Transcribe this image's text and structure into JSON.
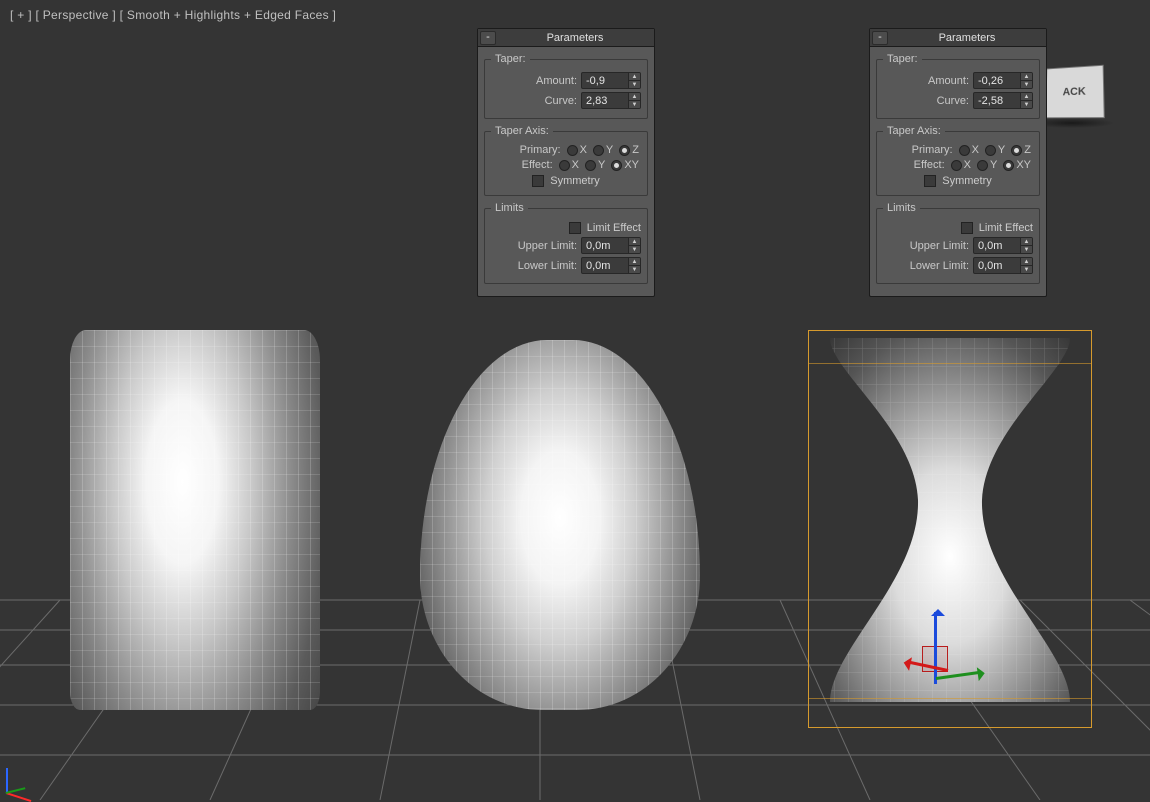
{
  "viewport_label": "[ + ] [ Perspective ] [ Smooth + Highlights + Edged Faces ]",
  "viewcube_face": "ACK",
  "panels": [
    {
      "title": "Parameters",
      "taper": {
        "legend": "Taper:",
        "amount_label": "Amount:",
        "amount_value": "-0,9",
        "curve_label": "Curve:",
        "curve_value": "2,83"
      },
      "axis": {
        "legend": "Taper Axis:",
        "primary_label": "Primary:",
        "primary_options": [
          "X",
          "Y",
          "Z"
        ],
        "primary_selected": "Z",
        "effect_label": "Effect:",
        "effect_options": [
          "X",
          "Y",
          "XY"
        ],
        "effect_selected": "XY",
        "symmetry_label": "Symmetry",
        "symmetry_checked": false
      },
      "limits": {
        "legend": "Limits",
        "limit_effect_label": "Limit Effect",
        "limit_effect_checked": false,
        "upper_label": "Upper Limit:",
        "upper_value": "0,0m",
        "lower_label": "Lower Limit:",
        "lower_value": "0,0m"
      }
    },
    {
      "title": "Parameters",
      "taper": {
        "legend": "Taper:",
        "amount_label": "Amount:",
        "amount_value": "-0,26",
        "curve_label": "Curve:",
        "curve_value": "-2,58"
      },
      "axis": {
        "legend": "Taper Axis:",
        "primary_label": "Primary:",
        "primary_options": [
          "X",
          "Y",
          "Z"
        ],
        "primary_selected": "Z",
        "effect_label": "Effect:",
        "effect_options": [
          "X",
          "Y",
          "XY"
        ],
        "effect_selected": "XY",
        "symmetry_label": "Symmetry",
        "symmetry_checked": false
      },
      "limits": {
        "legend": "Limits",
        "limit_effect_label": "Limit Effect",
        "limit_effect_checked": false,
        "upper_label": "Upper Limit:",
        "upper_value": "0,0m",
        "lower_label": "Lower Limit:",
        "lower_value": "0,0m"
      }
    }
  ]
}
